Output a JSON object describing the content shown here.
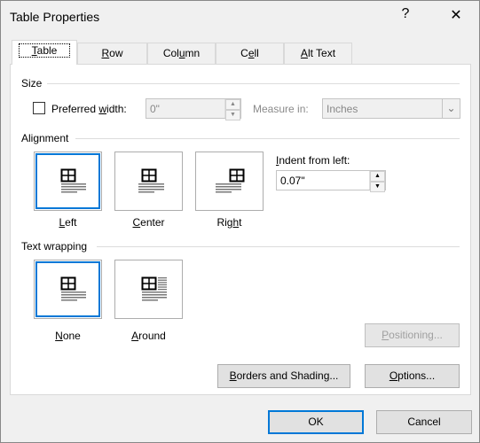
{
  "window": {
    "title": "Table Properties",
    "help": "?",
    "close": "✕"
  },
  "tabs": [
    {
      "label": "Table",
      "ul": 0,
      "active": true
    },
    {
      "label": "Row",
      "ul": 0
    },
    {
      "label": "Column",
      "ul": 3
    },
    {
      "label": "Cell",
      "ul": 1
    },
    {
      "label": "Alt Text",
      "ul": 0
    }
  ],
  "size": {
    "group": "Size",
    "preferred_width_label": "Preferred width:",
    "preferred_width_checked": false,
    "width_value": "0\"",
    "measure_label": "Measure in:",
    "measure_value": "Inches"
  },
  "alignment": {
    "group": "Alignment",
    "options": [
      {
        "label": "Left",
        "ul": 0,
        "selected": true
      },
      {
        "label": "Center",
        "ul": 0
      },
      {
        "label": "Right",
        "ul": 3
      }
    ],
    "indent_label": "Indent from left:",
    "indent_value": "0.07\""
  },
  "wrapping": {
    "group": "Text wrapping",
    "options": [
      {
        "label": "None",
        "ul": 0,
        "selected": true
      },
      {
        "label": "Around",
        "ul": 0
      }
    ]
  },
  "buttons": {
    "positioning": "Positioning...",
    "borders": "Borders and Shading...",
    "options": "Options...",
    "ok": "OK",
    "cancel": "Cancel"
  },
  "colors": {
    "accent": "#0078d7"
  }
}
